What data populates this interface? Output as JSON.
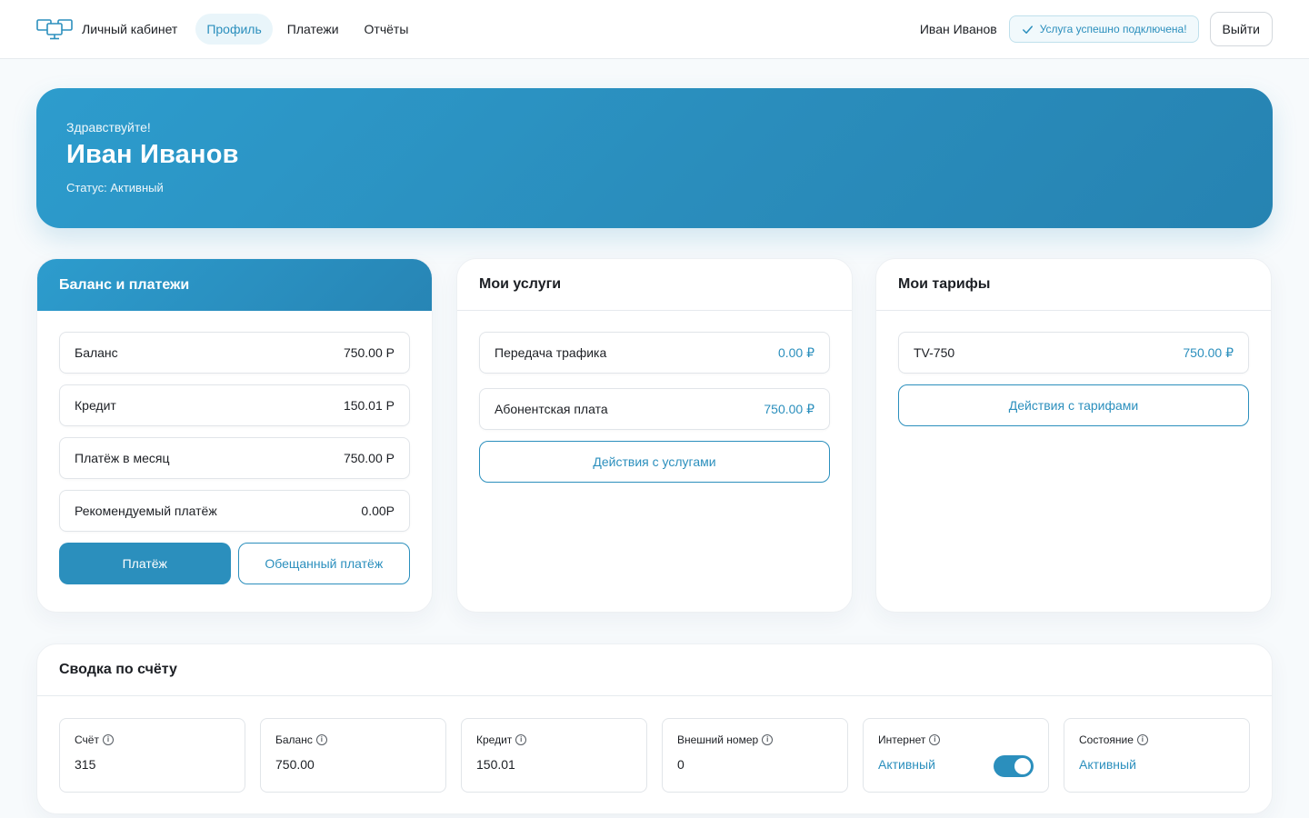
{
  "header": {
    "brand": "Личный кабинет",
    "nav": [
      {
        "label": "Профиль",
        "active": true
      },
      {
        "label": "Платежи",
        "active": false
      },
      {
        "label": "Отчёты",
        "active": false
      }
    ],
    "user_name": "Иван Иванов",
    "toast": "Услуга успешно подключена!",
    "logout": "Выйти"
  },
  "hero": {
    "greeting": "Здравствуйте!",
    "name": "Иван Иванов",
    "status": "Статус: Активный"
  },
  "balance_card": {
    "title": "Баланс и платежи",
    "rows": [
      {
        "label": "Баланс",
        "value": "750.00 Р"
      },
      {
        "label": "Кредит",
        "value": "150.01 Р"
      },
      {
        "label": "Платёж в месяц",
        "value": "750.00 Р"
      },
      {
        "label": "Рекомендуемый платёж",
        "value": "0.00Р"
      }
    ],
    "pay_button": "Платёж",
    "promised_button": "Обещанный платёж"
  },
  "services_card": {
    "title": "Мои услуги",
    "rows": [
      {
        "label": "Передача трафика",
        "value": "0.00 ₽"
      },
      {
        "label": "Абонентская плата",
        "value": "750.00 ₽"
      }
    ],
    "action_button": "Действия с услугами"
  },
  "tariffs_card": {
    "title": "Мои тарифы",
    "rows": [
      {
        "label": "TV-750",
        "value": "750.00 ₽"
      }
    ],
    "action_button": "Действия с тарифами"
  },
  "summary": {
    "title": "Сводка по счёту",
    "tiles": [
      {
        "label": "Счёт",
        "value": "315"
      },
      {
        "label": "Баланс",
        "value": "750.00"
      },
      {
        "label": "Кредит",
        "value": "150.01"
      },
      {
        "label": "Внешний номер",
        "value": "0"
      },
      {
        "label": "Интернет",
        "value": "Активный",
        "toggle_on": true
      },
      {
        "label": "Состояние",
        "value": "Активный"
      }
    ]
  },
  "colors": {
    "accent": "#2b8fbd",
    "accent_light": "#e9f5fa"
  }
}
